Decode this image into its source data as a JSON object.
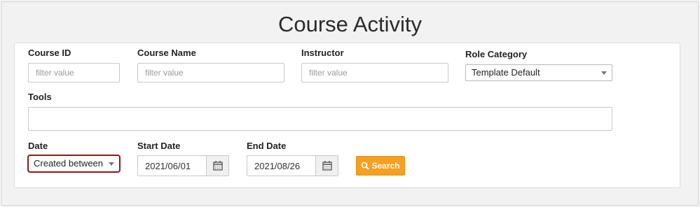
{
  "page": {
    "title": "Course Activity"
  },
  "filters": {
    "course_id": {
      "label": "Course ID",
      "placeholder": "filter value"
    },
    "course_name": {
      "label": "Course Name",
      "placeholder": "filter value"
    },
    "instructor": {
      "label": "Instructor",
      "placeholder": "filter value"
    },
    "role_category": {
      "label": "Role Category",
      "value": "Template Default"
    },
    "tools": {
      "label": "Tools",
      "value": ""
    },
    "date": {
      "label": "Date",
      "value": "Created between",
      "highlight_color": "#8b1a1a"
    },
    "start_date": {
      "label": "Start Date",
      "value": "2021/06/01"
    },
    "end_date": {
      "label": "End Date",
      "value": "2021/08/26"
    }
  },
  "search_button": {
    "label": "Search",
    "color": "#f5a020",
    "icon": "search-icon"
  }
}
